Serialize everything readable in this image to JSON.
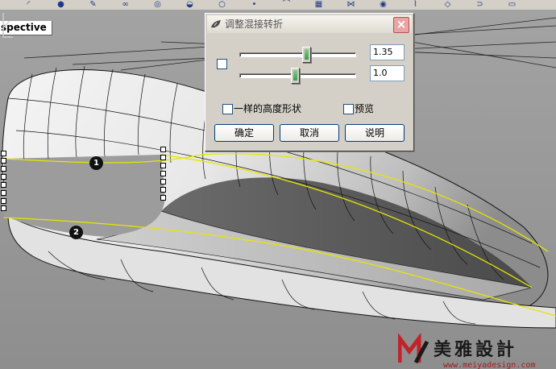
{
  "viewport": {
    "label": "spective"
  },
  "markers": [
    "1",
    "2"
  ],
  "dialog": {
    "title": "调整混接转折",
    "close_glyph": "×",
    "value1": "1.35",
    "value2": "1.0",
    "slider1_level": 0.58,
    "slider2_level": 0.48,
    "same_height_label": "一样的高度形状",
    "preview_label": "预览",
    "ok_label": "确定",
    "cancel_label": "取消",
    "help_label": "说明"
  },
  "watermark": {
    "title": "美雅設計",
    "url": "www.meiyadesign.com"
  },
  "colors": {
    "dialog_bg": "#d4d0c8",
    "curve_highlight": "#e6e600",
    "viewport_bg": "#9a9a9a"
  },
  "toolbar_icons": [
    "arc-icon",
    "sphere-icon",
    "edit-icon",
    "loop-icon",
    "surface-icon",
    "dome-icon",
    "torus-icon",
    "point-icon",
    "curve-icon",
    "mesh-icon",
    "blend-icon",
    "target-icon",
    "sweep-icon",
    "patch-icon",
    "offset-icon",
    "shell-icon"
  ]
}
